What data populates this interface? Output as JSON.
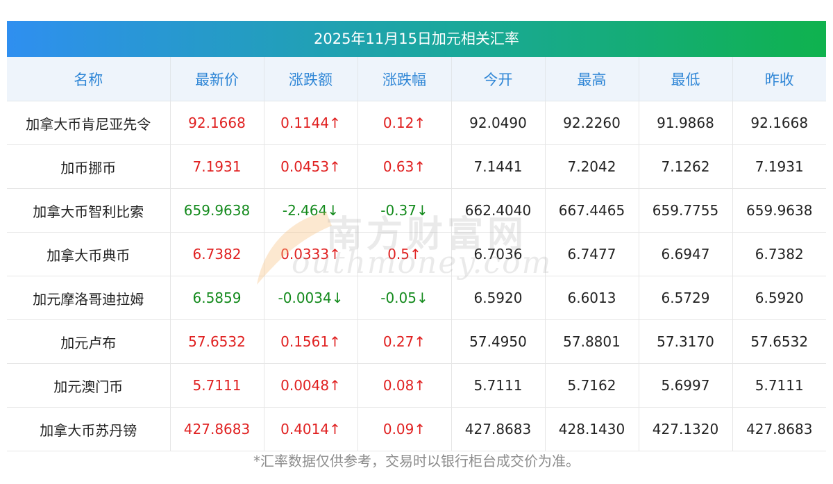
{
  "title": "2025年11月15日加元相关汇率",
  "headers": [
    "名称",
    "最新价",
    "涨跌额",
    "涨跌幅",
    "今开",
    "最高",
    "最低",
    "昨收"
  ],
  "rows": [
    {
      "name": "加拿大币肯尼亚先令",
      "latest": "92.1668",
      "change": "0.1144↑",
      "pct": "0.12↑",
      "open": "92.0490",
      "high": "92.2260",
      "low": "91.9868",
      "prev": "92.1668",
      "dir": "up"
    },
    {
      "name": "加币挪币",
      "latest": "7.1931",
      "change": "0.0453↑",
      "pct": "0.63↑",
      "open": "7.1441",
      "high": "7.2042",
      "low": "7.1262",
      "prev": "7.1931",
      "dir": "up"
    },
    {
      "name": "加拿大币智利比索",
      "latest": "659.9638",
      "change": "-2.464↓",
      "pct": "-0.37↓",
      "open": "662.4040",
      "high": "667.4465",
      "low": "659.7755",
      "prev": "659.9638",
      "dir": "down"
    },
    {
      "name": "加拿大币典币",
      "latest": "6.7382",
      "change": "0.0333↑",
      "pct": "0.5↑",
      "open": "6.7036",
      "high": "6.7477",
      "low": "6.6947",
      "prev": "6.7382",
      "dir": "up"
    },
    {
      "name": "加元摩洛哥迪拉姆",
      "latest": "6.5859",
      "change": "-0.0034↓",
      "pct": "-0.05↓",
      "open": "6.5920",
      "high": "6.6013",
      "low": "6.5729",
      "prev": "6.5920",
      "dir": "down"
    },
    {
      "name": "加元卢布",
      "latest": "57.6532",
      "change": "0.1561↑",
      "pct": "0.27↑",
      "open": "57.4950",
      "high": "57.8801",
      "low": "57.3170",
      "prev": "57.6532",
      "dir": "up"
    },
    {
      "name": "加元澳门币",
      "latest": "5.7111",
      "change": "0.0048↑",
      "pct": "0.08↑",
      "open": "5.7111",
      "high": "5.7162",
      "low": "5.6997",
      "prev": "5.7111",
      "dir": "up"
    },
    {
      "name": "加拿大币苏丹镑",
      "latest": "427.8683",
      "change": "0.4014↑",
      "pct": "0.09↑",
      "open": "427.8683",
      "high": "428.1430",
      "low": "427.1320",
      "prev": "427.8683",
      "dir": "up"
    }
  ],
  "footnote": "*汇率数据仅供参考，交易时以银行柜台成交价为准。",
  "watermark": {
    "cn": "南方财富网",
    "en": "outhmoney.com"
  },
  "colors": {
    "up": "#e02020",
    "down": "#138a1c",
    "header_text": "#2f86d6"
  }
}
